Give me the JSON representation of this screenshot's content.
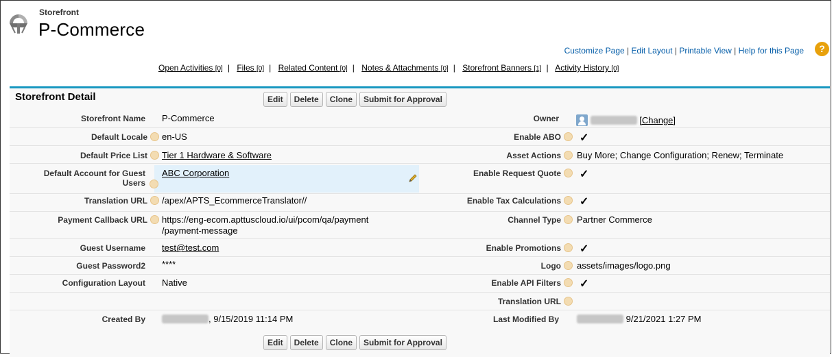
{
  "header": {
    "eyebrow": "Storefront",
    "title": "P-Commerce",
    "links": [
      "Customize Page",
      "Edit Layout",
      "Printable View",
      "Help for this Page"
    ],
    "help_icon": "?"
  },
  "related_lists": [
    {
      "label": "Open Activities",
      "count": "[0]"
    },
    {
      "label": "Files",
      "count": "[0]"
    },
    {
      "label": "Related Content",
      "count": "[0]"
    },
    {
      "label": "Notes & Attachments",
      "count": "[0]"
    },
    {
      "label": "Storefront Banners",
      "count": "[1]"
    },
    {
      "label": "Activity History",
      "count": "[0]"
    }
  ],
  "detail": {
    "title": "Storefront Detail",
    "buttons": [
      "Edit",
      "Delete",
      "Clone",
      "Submit for Approval"
    ]
  },
  "fields": {
    "storefront_name": {
      "label": "Storefront Name",
      "value": "P-Commerce"
    },
    "owner": {
      "label": "Owner",
      "change": "[Change]"
    },
    "default_locale": {
      "label": "Default Locale",
      "value": "en-US"
    },
    "enable_abo": {
      "label": "Enable ABO",
      "value": "✓"
    },
    "default_price_list": {
      "label": "Default Price List",
      "value": "Tier 1 Hardware & Software"
    },
    "asset_actions": {
      "label": "Asset Actions",
      "value": "Buy More; Change Configuration; Renew; Terminate"
    },
    "default_account_guest": {
      "label_line1": "Default Account for Guest",
      "label_line2": "Users",
      "value": "ABC Corporation"
    },
    "enable_request_quote": {
      "label": "Enable Request Quote",
      "value": "✓"
    },
    "translation_url": {
      "label": "Translation URL",
      "value": "/apex/APTS_EcommerceTranslator//"
    },
    "enable_tax_calculations": {
      "label": "Enable Tax Calculations",
      "value": "✓"
    },
    "payment_callback_url": {
      "label": "Payment Callback URL",
      "value_line1": "https://eng-ecom.apttuscloud.io/ui/pcom/qa/payment",
      "value_line2": "/payment-message"
    },
    "channel_type": {
      "label": "Channel Type",
      "value": "Partner Commerce"
    },
    "guest_username": {
      "label": "Guest Username",
      "value": "test@test.com"
    },
    "enable_promotions": {
      "label": "Enable Promotions",
      "value": "✓"
    },
    "guest_password2": {
      "label": "Guest Password2",
      "value": "****"
    },
    "logo": {
      "label": "Logo",
      "value": "assets/images/logo.png"
    },
    "configuration_layout": {
      "label": "Configuration Layout",
      "value": "Native"
    },
    "enable_api_filters": {
      "label": "Enable API Filters",
      "value": "✓"
    },
    "translation_url_right": {
      "label": "Translation URL",
      "value": ""
    },
    "created_by": {
      "label": "Created By",
      "value": ", 9/15/2019 11:14 PM"
    },
    "last_modified_by": {
      "label": "Last Modified By",
      "value": "9/21/2021 1:27 PM"
    }
  },
  "colors": {
    "accent": "#1797c0",
    "link": "#015ba7",
    "help": "#e8a10c",
    "highlight": "#e2f1fb"
  }
}
